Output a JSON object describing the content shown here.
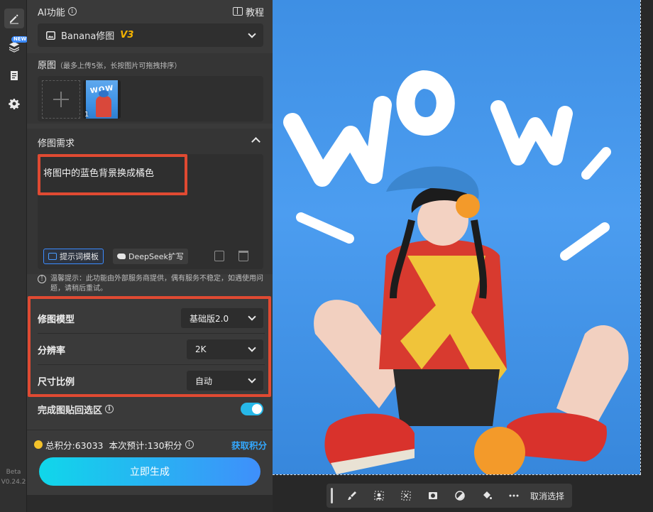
{
  "sidebar": {
    "badge": "NEW",
    "version_line1": "Beta",
    "version_line2": "V0.24.2"
  },
  "header": {
    "title": "AI功能",
    "tutorial": "教程"
  },
  "model_selector": {
    "value": "Banana修图",
    "version": "V3"
  },
  "original": {
    "title": "原图",
    "hint": "（最多上传5张，长按图片可拖拽排序）",
    "thumb_number": "1",
    "thumb_text": "WOW"
  },
  "requirements": {
    "title": "修图需求",
    "text": "将图中的蓝色背景换成橘色",
    "template_button": "提示词模板",
    "deepseek_button": "DeepSeek扩写"
  },
  "warning": "温馨提示：此功能由外部服务商提供，偶有服务不稳定，如遇使用问题，请稍后重试。",
  "options": [
    {
      "label": "修图模型",
      "value": "基础版2.0"
    },
    {
      "label": "分辨率",
      "value": "2K"
    },
    {
      "label": "尺寸比例",
      "value": "自动"
    }
  ],
  "paste_back": {
    "label": "完成图贴回选区",
    "enabled": true
  },
  "credits": {
    "total": "总积分:63033",
    "estimate": "本次预计:130积分",
    "get": "获取积分"
  },
  "generate_button": "立即生成",
  "canvas": {
    "image_text": "WOW",
    "cancel_selection": "取消选择"
  },
  "colors": {
    "accent": "#3B8BFF",
    "highlight_box": "#E04A32",
    "gen_gradient_start": "#10D7EA",
    "gen_gradient_end": "#3F8FFB",
    "toggle": "#27B8E8"
  }
}
